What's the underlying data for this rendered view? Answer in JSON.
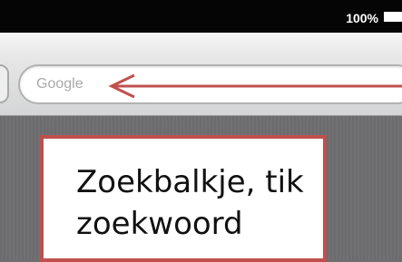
{
  "status_bar": {
    "battery_percent_label": "100%",
    "battery_icon": "battery-full-icon"
  },
  "browser": {
    "search_field": {
      "placeholder": "Google"
    }
  },
  "annotation": {
    "arrow_color": "#c0504d",
    "border_color": "#c0504d",
    "lines": [
      "Zoekbalkje, tik",
      "zoekwoord"
    ]
  }
}
